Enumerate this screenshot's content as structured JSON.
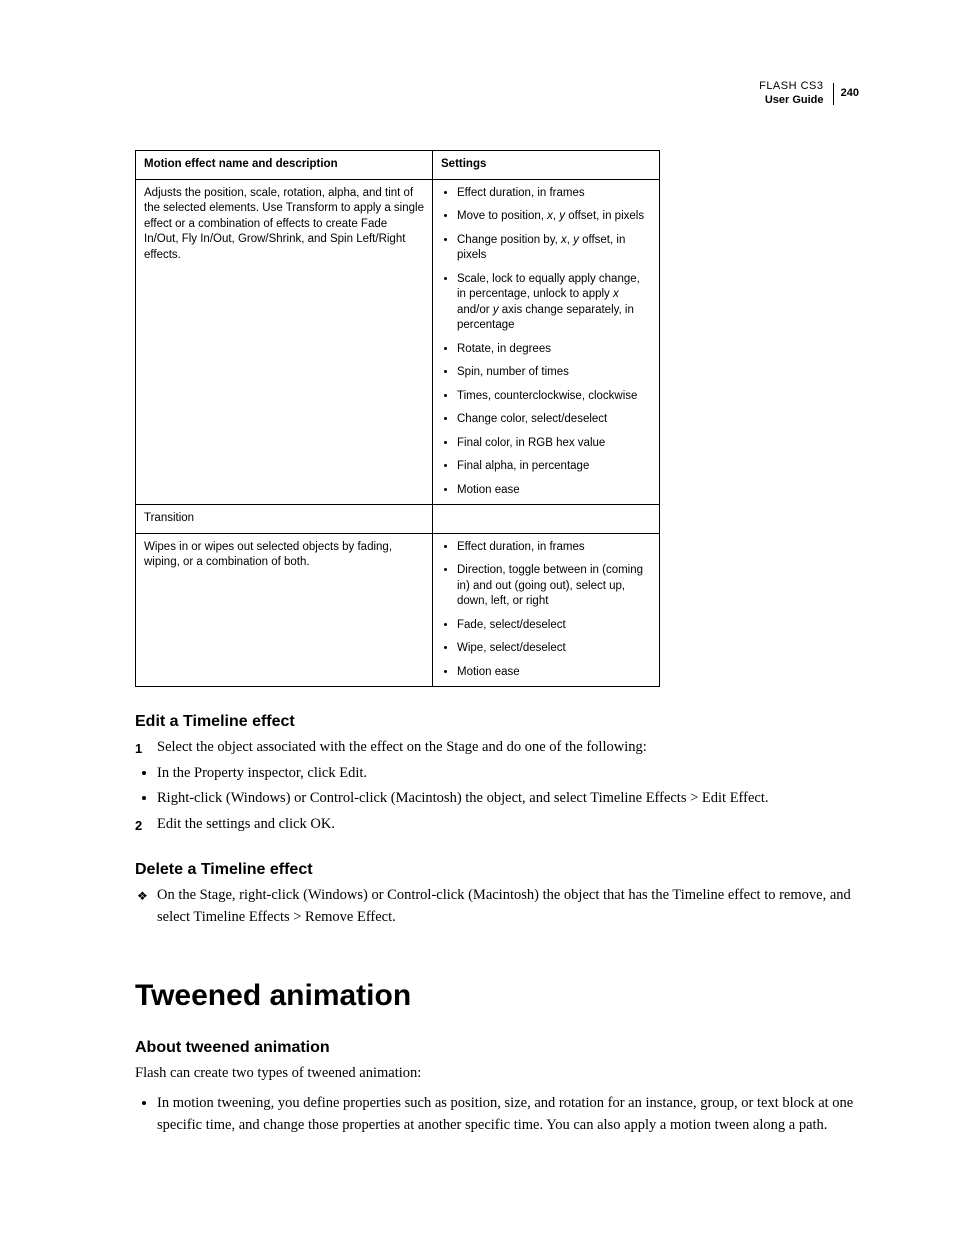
{
  "header": {
    "product": "FLASH CS3",
    "page_number": "240",
    "subtitle": "User Guide"
  },
  "table": {
    "headers": {
      "col1": "Motion effect name and description",
      "col2": "Settings"
    },
    "row1": {
      "desc": "Adjusts the position, scale, rotation, alpha, and tint of the selected elements. Use Transform to apply a single effect or a combination of effects to create Fade In/Out, Fly In/Out, Grow/Shrink, and Spin Left/Right effects.",
      "s1": "Effect duration, in frames",
      "s2a": "Move to position, ",
      "s2x": "x",
      "s2b": ", ",
      "s2y": "y",
      "s2c": " offset, in pixels",
      "s3a": "Change position by, ",
      "s3x": "x",
      "s3b": ", ",
      "s3y": "y",
      "s3c": " offset, in pixels",
      "s4a": "Scale, lock to equally apply change, in percentage, unlock to apply ",
      "s4x": "x",
      "s4b": " and/or ",
      "s4y": "y",
      "s4c": " axis change separately, in percentage",
      "s5": "Rotate, in degrees",
      "s6": "Spin, number of times",
      "s7": "Times, counterclockwise, clockwise",
      "s8": "Change color, select/deselect",
      "s9": "Final color, in RGB hex value",
      "s10": "Final alpha, in percentage",
      "s11": "Motion ease"
    },
    "row2": {
      "desc": "Transition"
    },
    "row3": {
      "desc": "Wipes in or wipes out selected objects by fading, wiping, or a combination of both.",
      "s1": "Effect duration, in frames",
      "s2": "Direction, toggle between in (coming in) and out (going out), select up, down, left, or right",
      "s3": "Fade, select/deselect",
      "s4": "Wipe, select/deselect",
      "s5": "Motion ease"
    }
  },
  "sections": {
    "edit": {
      "title": "Edit a Timeline effect",
      "step1": "Select the object associated with the effect on the Stage and do one of the following:",
      "bullet1": "In the Property inspector, click Edit.",
      "bullet2": "Right-click (Windows) or Control-click (Macintosh) the object, and select Timeline Effects > Edit Effect.",
      "step2": "Edit the settings and click OK."
    },
    "delete": {
      "title": "Delete a Timeline effect",
      "text": "On the Stage, right-click (Windows) or Control-click (Macintosh) the object that has the Timeline effect to remove, and select Timeline Effects > Remove Effect."
    },
    "chapter": "Tweened animation",
    "about": {
      "title": "About tweened animation",
      "intro": "Flash can create two types of tweened animation:",
      "bullet1": "In motion tweening, you define properties such as position, size, and rotation for an instance, group, or text block at one specific time, and change those properties at another specific time. You can also apply a motion tween along a path."
    }
  }
}
